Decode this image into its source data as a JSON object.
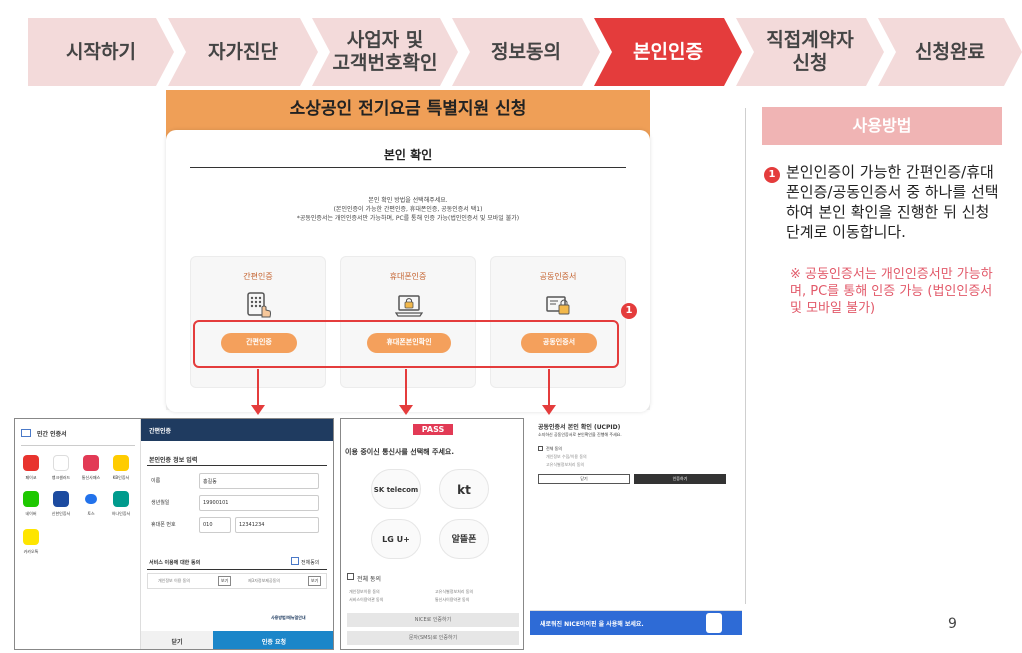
{
  "steps": [
    {
      "label": "시작하기",
      "active": false
    },
    {
      "label": "자가진단",
      "active": false
    },
    {
      "label": "사업자 및\n고객번호확인",
      "active": false
    },
    {
      "label": "정보동의",
      "active": false
    },
    {
      "label": "본인인증",
      "active": true
    },
    {
      "label": "직접계약자\n신청",
      "active": false
    },
    {
      "label": "신청완료",
      "active": false
    }
  ],
  "hero": {
    "title": "소상공인 전기요금 특별지원 신청",
    "subtitle": "본인 확인",
    "desc_1": "본인 확인 방법을 선택해주세요.",
    "desc_2": "(본인인증이 가능한 간편인증, 휴대폰인증, 공동인증서 택1)",
    "desc_3": "*공동인증서는 개인인증서만 가능하며, PC를 통해 인증 가능(법인인증서 및 모바일 불가)",
    "methods": [
      {
        "title": "간편인증",
        "button": "간편인증",
        "icon": "keypad-icon"
      },
      {
        "title": "휴대폰인증",
        "button": "휴대폰본인확인",
        "icon": "laptop-lock-icon"
      },
      {
        "title": "공동인증서",
        "button": "공동인증서",
        "icon": "certificate-icon"
      }
    ],
    "badge": "1"
  },
  "howto": {
    "header": "사용방법",
    "badge": "1",
    "text": "본인인증이 가능한 간편인증/휴대폰인증/공동인증서 중 하나를 선택하여 본인 확인을 진행한 뒤 신청단계로 이동합니다.",
    "note": "※ 공동인증서는 개인인증서만 가능하며, PC를 통해 인증 가능 (법인인증서 및 모바일 불가)"
  },
  "page_number": "9",
  "shot_simple": {
    "left_title": "민간 인증서",
    "apps": [
      {
        "name": "페이코",
        "color": "#e8332e",
        "glyph": "PAYCO"
      },
      {
        "name": "뱅크샐러드",
        "color": "#ffffff",
        "glyph": "●"
      },
      {
        "name": "통신사패스",
        "color": "#e23a55",
        "glyph": "PASS"
      },
      {
        "name": "KB인증서",
        "color": "#ffcc00",
        "glyph": "KB"
      },
      {
        "name": "네이버",
        "color": "#1ec800",
        "glyph": "N"
      },
      {
        "name": "신한인증서",
        "color": "#1c4ba0",
        "glyph": "S"
      },
      {
        "name": "토스",
        "color": "#ffffff",
        "glyph": "●"
      },
      {
        "name": "하나인증서",
        "color": "#009b8d",
        "glyph": "하"
      },
      {
        "name": "카카오톡",
        "color": "#fee500",
        "glyph": "TALK"
      }
    ],
    "header": "간편인증",
    "section": "본인인증 정보 입력",
    "fields": [
      {
        "label": "이름",
        "value": "홍길동"
      },
      {
        "label": "생년월일",
        "value": "19900101"
      },
      {
        "label": "휴대폰 번호",
        "value": "010",
        "value2": "12341234"
      }
    ],
    "consent_title": "서비스 이용에 대한 동의",
    "consent_all": "전체동의",
    "consent_1": "개인정보 이용 동의",
    "consent_2": "제3자정보제공동의",
    "view_btn": "보기",
    "guide": "사용방법/매뉴얼안내",
    "close": "닫기",
    "request": "인증 요청"
  },
  "shot_phone": {
    "logo": "PASS",
    "title": "이용 중이신 통신사를 선택해 주세요.",
    "telcos": [
      "SK telecom",
      "kt",
      "LG U+",
      "알뜰폰"
    ],
    "agree_all": "전체 동의",
    "agree_items": [
      "개인정보이용 동의",
      "고유식별정보처리 동의",
      "서비스이용약관 동의",
      "통신사이용약관 동의"
    ],
    "btn_nice": "NICE로 인증하기",
    "btn_qr": "문자(SMS)로 인증하기"
  },
  "shot_cert": {
    "title": "공동인증서 본인 확인 (UCPID)",
    "desc": "소지하신 공동인증서로 본인확인을 진행해 주세요.",
    "agree_all": "전체 동의",
    "agree_1": "개인정보 수집/이용 동의",
    "agree_2": "고유식별정보처리 동의",
    "close": "닫기",
    "confirm": "인증하기",
    "banner": "새로워진 NICE아이핀 을 사용해 보세요."
  }
}
